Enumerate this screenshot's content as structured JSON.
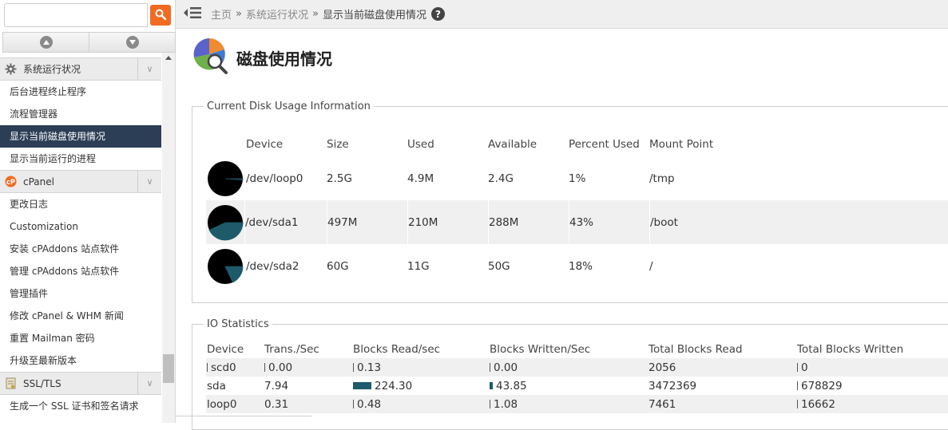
{
  "search": {
    "placeholder": "",
    "value": ""
  },
  "sidebar": {
    "groups": [
      {
        "label": "系统运行状况",
        "icon": "gear-icon"
      },
      {
        "label": "cPanel",
        "icon": "cpanel-logo-icon"
      },
      {
        "label": "SSL/TLS",
        "icon": "ssl-certificate-icon"
      }
    ],
    "group1_items": [
      "后台进程终止程序",
      "流程管理器",
      "显示当前磁盘使用情况",
      "显示当前运行的进程"
    ],
    "group2_items": [
      "更改日志",
      "Customization",
      "安装 cPAddons 站点软件",
      "管理 cPAddons 站点软件",
      "管理插件",
      "修改 cPanel & WHM 新闻",
      "重置 Mailman 密码",
      "升级至最新版本"
    ],
    "group3_items": [
      "生成一个 SSL 证书和签名请求"
    ],
    "active_item": "显示当前磁盘使用情况"
  },
  "breadcrumb": {
    "home": "主页",
    "separator": "»",
    "section": "系统运行状况",
    "current": "显示当前磁盘使用情况"
  },
  "page": {
    "title": "磁盘使用情况"
  },
  "disk": {
    "legend": "Current Disk Usage Information",
    "headers": {
      "device": "Device",
      "size": "Size",
      "used": "Used",
      "available": "Available",
      "percent": "Percent Used",
      "mount": "Mount Point"
    },
    "rows": [
      {
        "device": "/dev/loop0",
        "size": "2.5G",
        "used": "4.9M",
        "available": "2.4G",
        "percent": "1%",
        "mount": "/tmp",
        "fraction": 0.01
      },
      {
        "device": "/dev/sda1",
        "size": "497M",
        "used": "210M",
        "available": "288M",
        "percent": "43%",
        "mount": "/boot",
        "fraction": 0.43
      },
      {
        "device": "/dev/sda2",
        "size": "60G",
        "used": "11G",
        "available": "50G",
        "percent": "18%",
        "mount": "/",
        "fraction": 0.18
      }
    ]
  },
  "io": {
    "legend": "IO Statistics",
    "headers": {
      "device": "Device",
      "tps": "Trans./Sec",
      "blocks_read": "Blocks Read/sec",
      "blocks_written": "Blocks Written/Sec",
      "total_read": "Total Blocks Read",
      "total_written": "Total Blocks Written"
    },
    "rows": [
      {
        "device": "scd0",
        "tps": "0.00",
        "blocks_read": "0.13",
        "blocks_written": "0.00",
        "total_read": "2056",
        "total_written": "0"
      },
      {
        "device": "sda",
        "tps": "7.94",
        "blocks_read": "224.30",
        "blocks_written": "43.85",
        "total_read": "3472369",
        "total_written": "678829"
      },
      {
        "device": "loop0",
        "tps": "0.31",
        "blocks_read": "0.48",
        "blocks_written": "1.08",
        "total_read": "7461",
        "total_written": "16662"
      }
    ]
  },
  "colors": {
    "accent": "#f26b21",
    "active_bg": "#2b3e55",
    "pie_used": "#1d5a6a",
    "pie_bg": "#000000"
  }
}
